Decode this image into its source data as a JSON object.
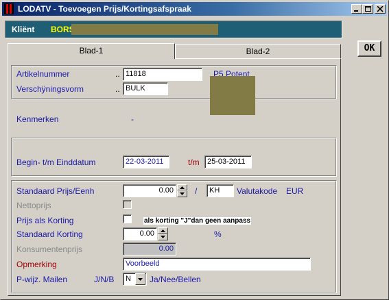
{
  "window": {
    "title": "LODATV - Toevoegen Prijs/Kortingsafspraak",
    "colors": {
      "titlebar": "#0a246a",
      "client_bar": "#1e5f75",
      "client_value": "#ffff00",
      "redaction": "#837b45",
      "label_blue": "#1a1aa8",
      "label_red": "#a00000"
    }
  },
  "client": {
    "label": "Kliënt",
    "value": "BORS"
  },
  "ok_button": {
    "label": "OK"
  },
  "tabs": [
    {
      "label": "Blad-1",
      "active": true
    },
    {
      "label": "Blad-2",
      "active": false
    }
  ],
  "article": {
    "artikelnummer_label": "Artikelnummer",
    "artikelnummer_dots": "..",
    "artikelnummer_value": "11818",
    "verschijning_label": "Verschÿningsvorm",
    "verschijning_dots": "..",
    "verschijning_value": "BULK",
    "extra_text": "P5 Potent"
  },
  "kenmerken": {
    "label": "Kenmerken",
    "value": "-"
  },
  "dates": {
    "label": "Begin- t/m Einddatum",
    "begin": "22-03-2011",
    "sep": "t/m",
    "end": "25-03-2011"
  },
  "pricing": {
    "standaard_prijs_label": "Standaard Prijs/Eenh",
    "standaard_prijs_value": "0.00",
    "slash": "/",
    "unit": "KH",
    "valuta_label": "Valutakode",
    "valuta_value": "EUR",
    "nettoprijs_label": "Nettoprijs",
    "prijs_als_korting_label": "Prijs als Korting",
    "korting_note": "als korting \"J\"dan geen aanpass",
    "standaard_korting_label": "Standaard Korting",
    "standaard_korting_value": "0.00",
    "percent": "%",
    "konsumentenprijs_label": "Konsumentenprijs",
    "konsumentenprijs_value": "0.00",
    "opmerking_label": "Opmerking",
    "opmerking_value": "Voorbeeld",
    "mailen_label": "P-wijz. Mailen",
    "mailen_options": "J/N/B",
    "mailen_value": "N",
    "mailen_legend": "Ja/Nee/Bellen"
  }
}
